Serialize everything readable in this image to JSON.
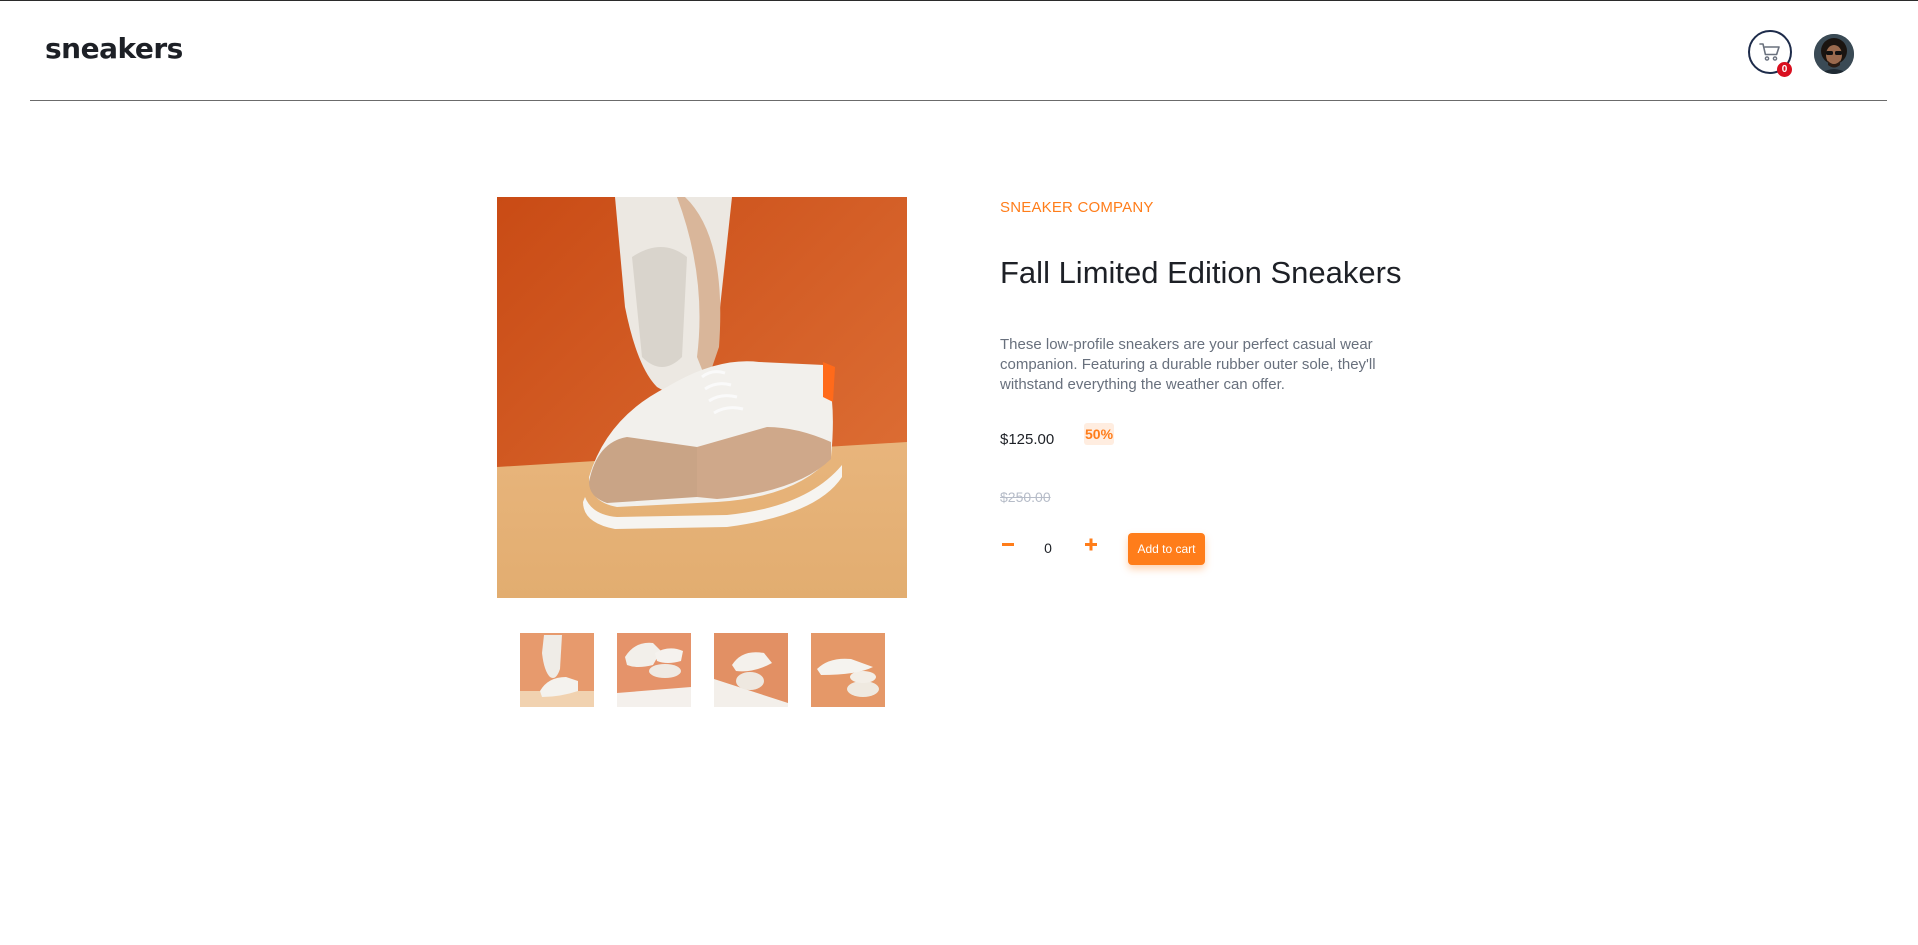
{
  "header": {
    "logo": "sneakers",
    "cart_count": "0"
  },
  "gallery": {
    "main_alt": "Fall Limited Edition Sneakers product image",
    "thumbnails": [
      "thumbnail 1",
      "thumbnail 2",
      "thumbnail 3",
      "thumbnail 4"
    ]
  },
  "product": {
    "company": "SNEAKER COMPANY",
    "title": "Fall Limited Edition Sneakers",
    "description": "These low-profile sneakers are your perfect casual wear companion. Featuring a durable rubber outer sole, they'll withstand everything the weather can offer.",
    "price": "$125.00",
    "discount": "50%",
    "old_price": "$250.00",
    "quantity": "0",
    "add_to_cart": "Add to cart"
  },
  "colors": {
    "accent": "#ff7d1a",
    "accent_pale": "#ffede0",
    "text_dark": "#1d2026",
    "text_muted": "#68707d",
    "badge_red": "#d90f1f"
  },
  "icons": {
    "cart": "cart-icon",
    "minus": "minus-icon",
    "plus": "plus-icon"
  }
}
